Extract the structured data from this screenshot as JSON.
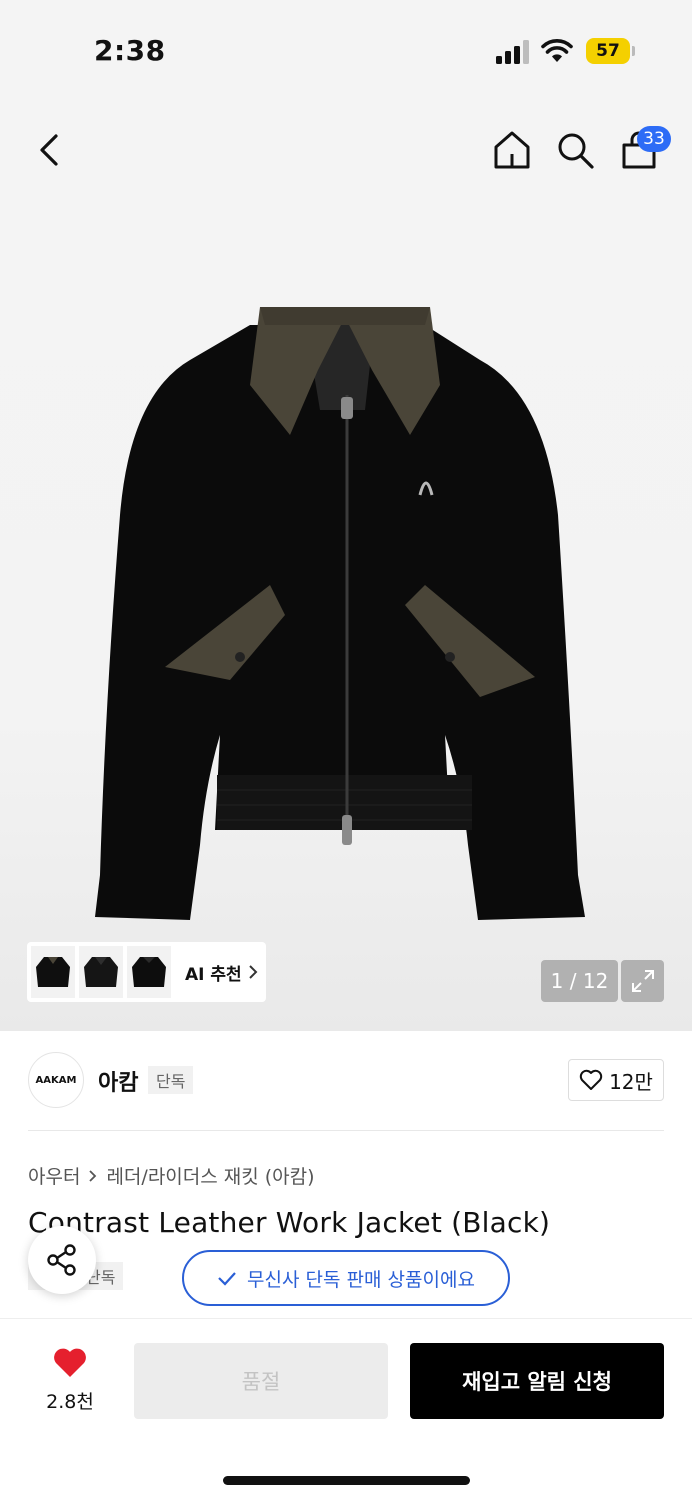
{
  "status_bar": {
    "time": "2:38",
    "battery": "57"
  },
  "header": {
    "cart_count": "33"
  },
  "gallery": {
    "ai_recommend_label": "AI 추천",
    "page_indicator": "1 / 12",
    "thumbnail_count": 3
  },
  "brand": {
    "logo_text": "AAKAM",
    "name": "아캄",
    "tag": "단독",
    "likes": "12만"
  },
  "breadcrumb": {
    "category": "아우터",
    "subcategory": "레더/라이더스 재킷 (아캄)"
  },
  "product": {
    "title": "Contrast Leather Work Jacket (Black)",
    "exclusive_tag": "단독",
    "musinsa_exclusive": "무신사 단독 판매 상품이에요"
  },
  "bottom_bar": {
    "wish_count": "2.8천",
    "soldout_label": "품절",
    "restock_label": "재입고 알림 신청"
  },
  "colors": {
    "accent_blue": "#2a5fd6",
    "badge_blue": "#2d6cf6",
    "heart_red": "#e5202e",
    "battery_yellow": "#f4d000"
  }
}
